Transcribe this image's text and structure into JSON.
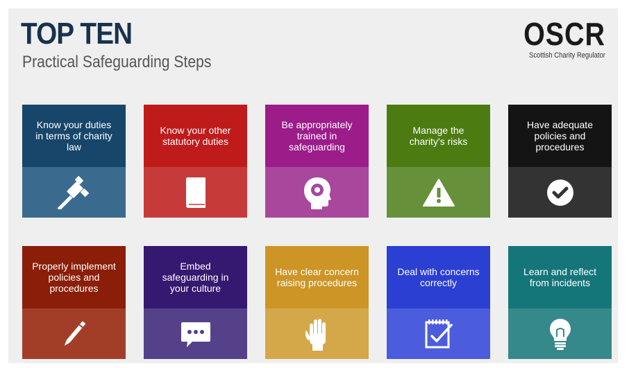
{
  "header": {
    "title": "TOP TEN",
    "subtitle": "Practical Safeguarding Steps"
  },
  "logo": {
    "name": "OSCR",
    "tagline": "Scottish Charity Regulator"
  },
  "cards": [
    {
      "label": "Know your duties in terms of charity law",
      "icon": "gavel-icon",
      "top_color": "#17466a",
      "bottom_color": "#3a6a8e"
    },
    {
      "label": "Know your other statutory duties",
      "icon": "book-icon",
      "top_color": "#bf1b1b",
      "bottom_color": "#c73a3a"
    },
    {
      "label": "Be appropriately trained in safeguarding",
      "icon": "head-icon",
      "top_color": "#9c1c8a",
      "bottom_color": "#a8479c"
    },
    {
      "label": "Manage the charity's risks",
      "icon": "warning-icon",
      "top_color": "#4c7b12",
      "bottom_color": "#66903a"
    },
    {
      "label": "Have adequate policies and procedures",
      "icon": "check-circle-icon",
      "top_color": "#141414",
      "bottom_color": "#333333"
    },
    {
      "label": "Properly implement policies and procedures",
      "icon": "pen-icon",
      "top_color": "#8a1e08",
      "bottom_color": "#a23e28"
    },
    {
      "label": "Embed safeguarding in your culture",
      "icon": "chat-icon",
      "top_color": "#35186f",
      "bottom_color": "#54418a"
    },
    {
      "label": "Have clear concern raising procedures",
      "icon": "hand-icon",
      "top_color": "#cd9526",
      "bottom_color": "#d4a848"
    },
    {
      "label": "Deal with concerns correctly",
      "icon": "checklist-icon",
      "top_color": "#2b3fd2",
      "bottom_color": "#4b5cdd"
    },
    {
      "label": "Learn and reflect from incidents",
      "icon": "lightbulb-icon",
      "top_color": "#15767a",
      "bottom_color": "#36898b"
    }
  ]
}
